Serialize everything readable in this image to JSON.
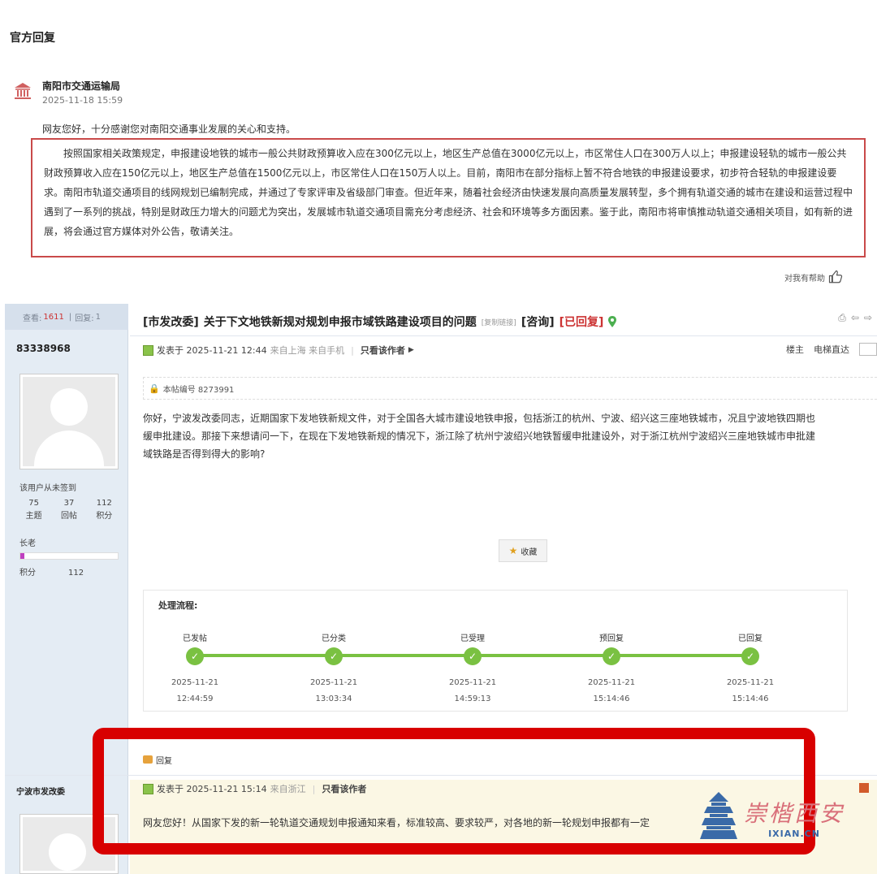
{
  "top": {
    "section_title": "官方回复",
    "org_name": "南阳市交通运输局",
    "org_time": "2025-11-18 15:59",
    "greeting": "网友您好，十分感谢您对南阳交通事业发展的关心和支持。",
    "reply_text": "按照国家相关政策规定，申报建设地铁的城市一般公共财政预算收入应在300亿元以上，地区生产总值在3000亿元以上，市区常住人口在300万人以上；申报建设轻轨的城市一般公共财政预算收入应在150亿元以上，地区生产总值在1500亿元以上，市区常住人口在150万人以上。目前，南阳市在部分指标上暂不符合地铁的申报建设要求，初步符合轻轨的申报建设要求。南阳市轨道交通项目的线网规划已编制完成，并通过了专家评审及省级部门审查。但近年来，随着社会经济由快速发展向高质量发展转型，多个拥有轨道交通的城市在建设和运营过程中遇到了一系列的挑战，特别是财政压力增大的问题尤为突出，发展城市轨道交通项目需充分考虑经济、社会和环境等多方面因素。鉴于此，南阳市将审慎推动轨道交通相关项目，如有新的进展，将会通过官方媒体对外公告，敬请关注。",
    "helpful_label": "对我有帮助"
  },
  "forum": {
    "view_label": "查看:",
    "view_count": "1611",
    "reply_label": "回复:",
    "reply_count": "1",
    "thread_tag": "[市发改委]",
    "thread_title": "关于下文地铁新规对规划申报市域铁路建设项目的问题",
    "copy_link": "[复制链接]",
    "consult_tag": "[咨询]",
    "status_tag": "[已回复]",
    "user": {
      "name": "83338968",
      "signin": "该用户从未签到",
      "topics": "75",
      "topics_label": "主题",
      "posts": "37",
      "posts_label": "回帖",
      "points": "112",
      "points_label": "积分",
      "rank": "长老",
      "rank_progress": 0.04,
      "pts_label": "积分",
      "pts_value": "112"
    },
    "post_meta": {
      "posted": "发表于 2025-11-21 12:44",
      "source": "来自上海 来自手机",
      "only_author": "只看该作者",
      "floor": "楼主",
      "jump": "电梯直达"
    },
    "post_no": "本帖编号 8273991",
    "post_body": "你好，宁波发改委同志，近期国家下发地铁新规文件，对于全国各大城市建设地铁申报，包括浙江的杭州、宁波、绍兴这三座地铁城市，况且宁波地铁四期也\n缓申批建设。那接下来想请问一下，在现在下发地铁新规的情况下，浙江除了杭州宁波绍兴地铁暂缓申批建设外，对于浙江杭州宁波绍兴三座地铁城市申批建\n域铁路是否得到得大的影响?",
    "fav_label": "收藏",
    "flow_title": "处理流程:",
    "steps": [
      {
        "label": "已发帖",
        "date": "2025-11-21",
        "time": "12:44:59"
      },
      {
        "label": "已分类",
        "date": "2025-11-21",
        "time": "13:03:34"
      },
      {
        "label": "已受理",
        "date": "2025-11-21",
        "time": "14:59:13"
      },
      {
        "label": "预回复",
        "date": "2025-11-21",
        "time": "15:14:46"
      },
      {
        "label": "已回复",
        "date": "2025-11-21",
        "time": "15:14:46"
      }
    ],
    "reply_label_btn": "回复",
    "reply_user": "宁波市发改委",
    "reply_posted": "发表于 2025-11-21 15:14",
    "reply_source": "来自浙江",
    "reply_only_author": "只看该作者",
    "reply_text": "网友您好！从国家下发的新一轮轨道交通规划申报通知来看，标准较高、要求较严，对各地的新一轮规划申报都有一定"
  },
  "watermark": {
    "cn": "崇楷西安",
    "url": "IXIAN.CN"
  },
  "colors": {
    "highlight_red": "#d80000",
    "box_red": "#c94a4a",
    "progress_green": "#7ac142",
    "sidebar_blue": "#e4ecf4"
  }
}
